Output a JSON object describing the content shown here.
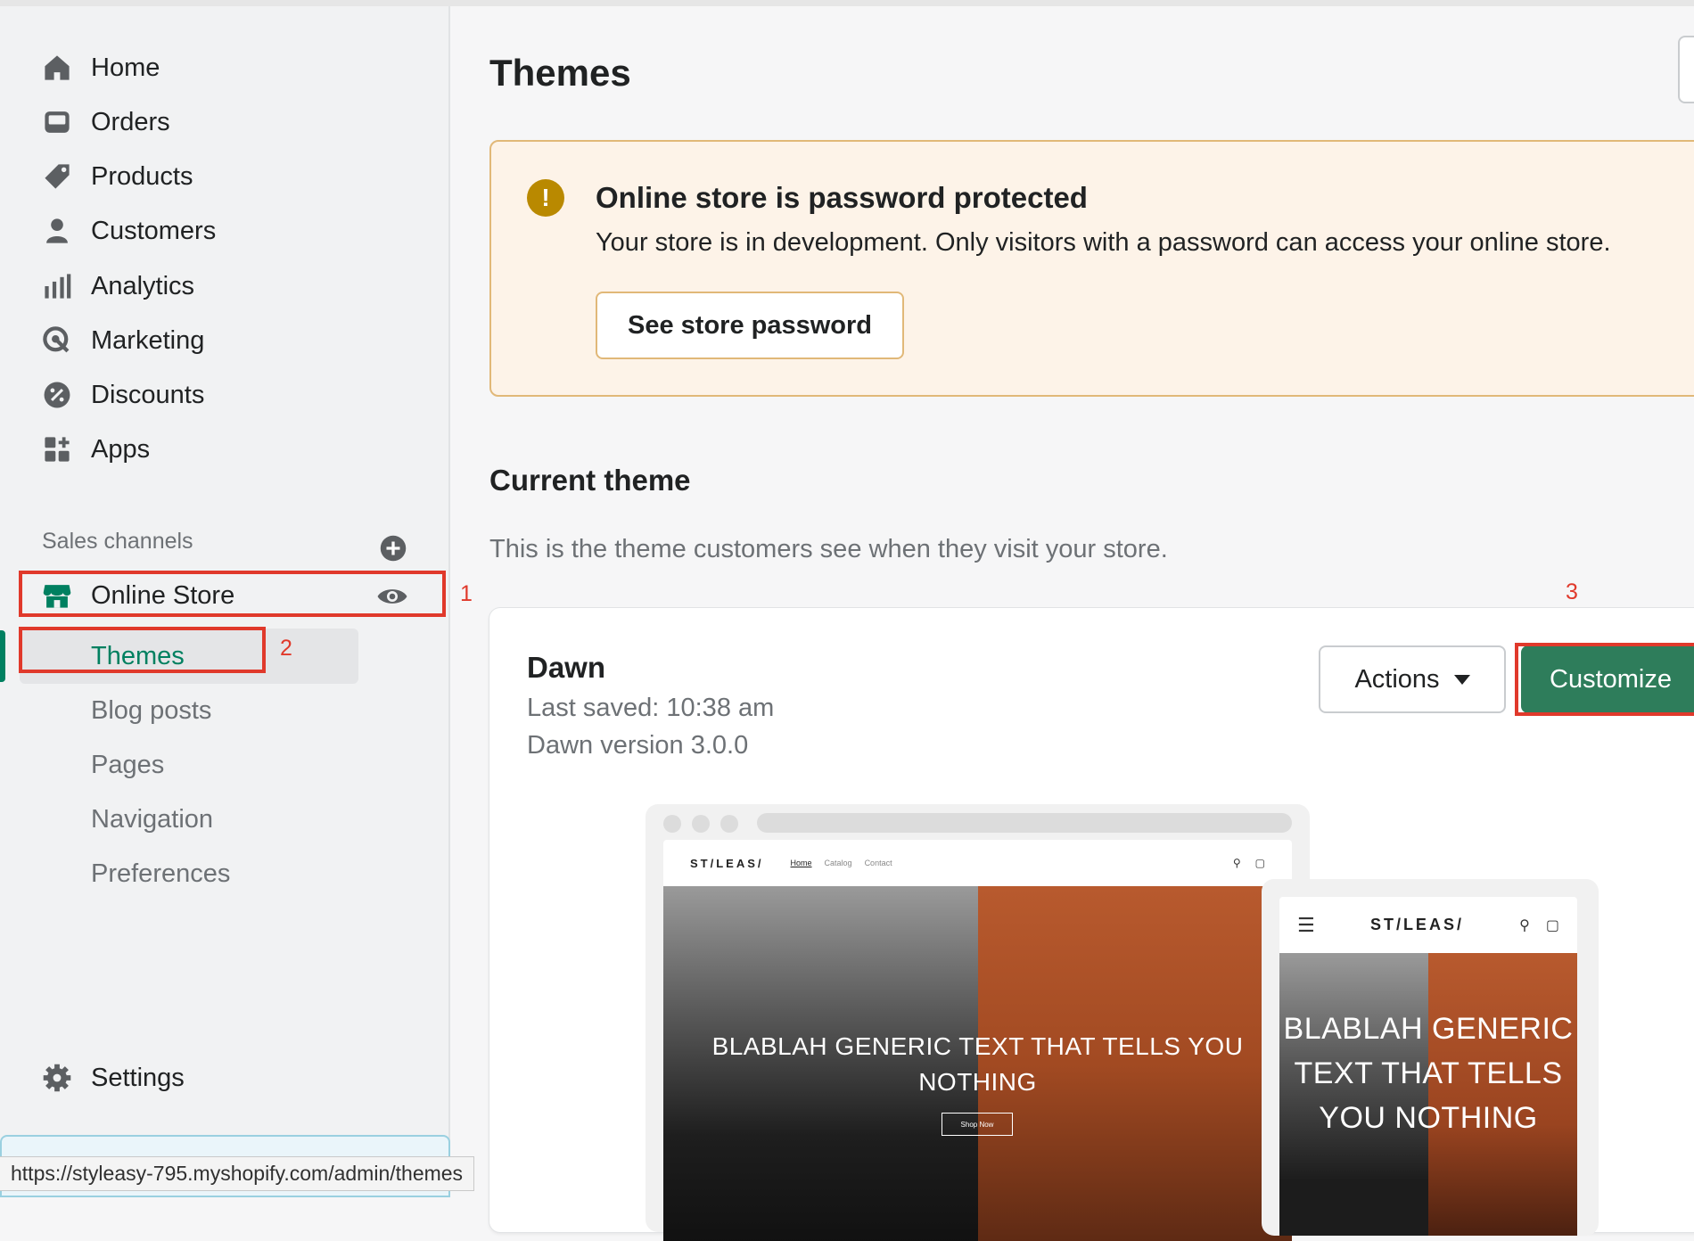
{
  "sidebar": {
    "items": [
      {
        "label": "Home",
        "icon": "home-icon"
      },
      {
        "label": "Orders",
        "icon": "inbox-icon"
      },
      {
        "label": "Products",
        "icon": "tag-icon"
      },
      {
        "label": "Customers",
        "icon": "person-icon"
      },
      {
        "label": "Analytics",
        "icon": "bar-chart-icon"
      },
      {
        "label": "Marketing",
        "icon": "target-icon"
      },
      {
        "label": "Discounts",
        "icon": "discount-icon"
      },
      {
        "label": "Apps",
        "icon": "apps-icon"
      }
    ],
    "sales_channels_title": "Sales channels",
    "online_store": "Online Store",
    "sub_items": [
      "Themes",
      "Blog posts",
      "Pages",
      "Navigation",
      "Preferences"
    ],
    "settings": "Settings"
  },
  "annotations": [
    "1",
    "2",
    "3"
  ],
  "status_url": "https://styleasy-795.myshopify.com/admin/themes",
  "main": {
    "title": "Themes",
    "banner": {
      "title": "Online store is password protected",
      "text": "Your store is in development. Only visitors with a password can access your online store.",
      "button": "See store password"
    },
    "current_theme": {
      "title": "Current theme",
      "description": "This is the theme customers see when they visit your store.",
      "name": "Dawn",
      "last_saved": "Last saved: 10:38 am",
      "version": "Dawn version 3.0.0",
      "actions_label": "Actions",
      "customize_label": "Customize"
    },
    "preview": {
      "logo": "ST/LEAS/",
      "nav_links": [
        "Home",
        "Catalog",
        "Contact"
      ],
      "hero_text": "BLABLAH GENERIC TEXT THAT TELLS YOU NOTHING",
      "hero_button": "Shop Now"
    }
  },
  "colors": {
    "accent": "#008060",
    "customize_bg": "#2e7d5b",
    "warning_bg": "#fdf3e8",
    "warning_border": "#e1b878",
    "annotation_red": "#e0392b"
  }
}
